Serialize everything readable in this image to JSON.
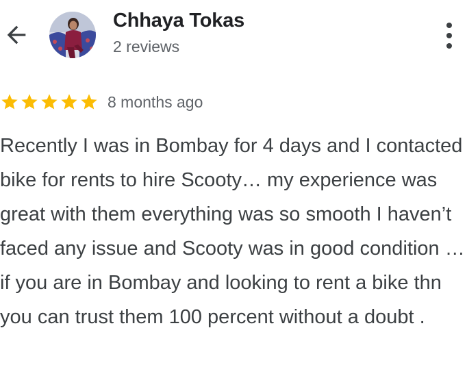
{
  "header": {
    "author_name": "Chhaya Tokas",
    "review_count": "2 reviews",
    "back_icon": "arrow-back-icon",
    "more_icon": "more-vert-icon"
  },
  "review": {
    "rating": 5,
    "rating_max": 5,
    "date": "8 months ago",
    "text": "Recently I was in Bombay for 4 days and I contacted bike for rents to hire Scooty… my experience was great with them everything was so smooth I haven’t faced any issue and Scooty was in good condition … if you are in Bombay and looking to rent a bike thn you can trust them 100 percent without a doubt ."
  },
  "colors": {
    "star": "#FBBC04",
    "name": "#202124",
    "secondary_text": "#5f6368",
    "body_text": "#3c4043",
    "icon": "#3c4043"
  }
}
